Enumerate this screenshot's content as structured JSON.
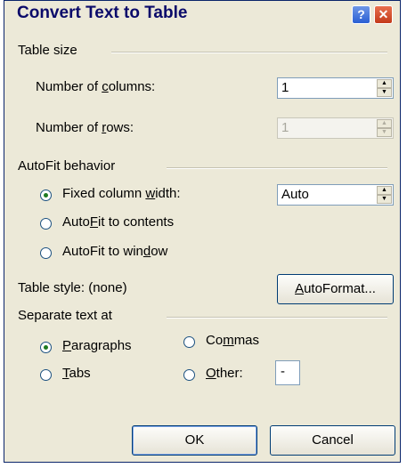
{
  "window": {
    "title": "Convert Text to Table",
    "help_glyph": "?",
    "close_glyph": "✕"
  },
  "table_size": {
    "heading": "Table size",
    "columns_label": [
      "Number of ",
      "c",
      "olumns:"
    ],
    "columns_value": "1",
    "rows_label": [
      "Number of ",
      "r",
      "ows:"
    ],
    "rows_value": "1"
  },
  "autofit": {
    "heading": "AutoFit behavior",
    "fixed_label": [
      "Fixed column ",
      "w",
      "idth:"
    ],
    "fixed_value": "Auto",
    "contents_label": [
      "Auto",
      "F",
      "it to contents"
    ],
    "window_label": [
      "AutoFit to win",
      "d",
      "ow"
    ],
    "selected": "fixed"
  },
  "style": {
    "label": "Table style:  (none)",
    "autoformat_button": [
      "",
      "A",
      "utoFormat..."
    ]
  },
  "separate": {
    "heading": "Separate text at",
    "paragraphs": [
      "",
      "P",
      "aragraphs"
    ],
    "commas": [
      "Co",
      "m",
      "mas"
    ],
    "tabs": [
      "",
      "T",
      "abs"
    ],
    "other": [
      "",
      "O",
      "ther:"
    ],
    "other_value": "-",
    "selected": "paragraphs"
  },
  "buttons": {
    "ok": "OK",
    "cancel": "Cancel"
  },
  "icons": {
    "spin_up": "▲",
    "spin_down": "▼"
  },
  "colors": {
    "title_text": "#0a0a6a",
    "dialog_bg": "#ece9d8",
    "close_red": "#c33a1a",
    "help_blue": "#2a5fd4"
  }
}
